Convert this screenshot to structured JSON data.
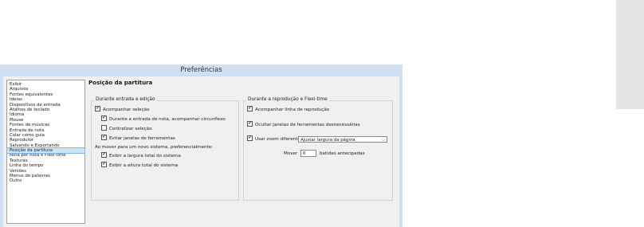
{
  "window": {
    "title": "Preferências"
  },
  "categories": [
    {
      "label": "Exibir",
      "selected": false
    },
    {
      "label": "Arquivos",
      "selected": false
    },
    {
      "label": "Fontes equivalentes",
      "selected": false
    },
    {
      "label": "Ideias",
      "selected": false
    },
    {
      "label": "Dispositivos de entrada",
      "selected": false
    },
    {
      "label": "Atalhos de teclado",
      "selected": false
    },
    {
      "label": "Idioma",
      "selected": false
    },
    {
      "label": "Mouse",
      "selected": false
    },
    {
      "label": "Fontes de músicas",
      "selected": false
    },
    {
      "label": "Entrada de nota",
      "selected": false
    },
    {
      "label": "Colar como guia",
      "selected": false
    },
    {
      "label": "Reprodutor",
      "selected": false
    },
    {
      "label": "Salvando e Exportando",
      "selected": false
    },
    {
      "label": "Posição da partitura",
      "selected": true
    },
    {
      "label": "Nota por nota e Flexi-time",
      "selected": false
    },
    {
      "label": "Texturas",
      "selected": false
    },
    {
      "label": "Linha do tempo",
      "selected": false
    },
    {
      "label": "Versões",
      "selected": false
    },
    {
      "label": "Menus de palavras",
      "selected": false
    },
    {
      "label": "Outro",
      "selected": false
    }
  ],
  "page_title": "Posição da partitura",
  "entry_group": {
    "title": "Durante entrada e edição",
    "follow_selection": {
      "label": "Acompanhar seleção",
      "checked": true
    },
    "follow_caret": {
      "label": "Durante a entrada de nota, acompanhar circunflexo",
      "checked": true
    },
    "center_selection": {
      "label": "Centralizar seleção",
      "checked": false
    },
    "avoid_toolbars": {
      "label": "Evitar janelas de ferramentas",
      "checked": true
    },
    "move_system_text": "Ao mover para um novo sistema, preferencialmente:",
    "full_width": {
      "label": "Exibir a largura total do sistema",
      "checked": true
    },
    "full_height": {
      "label": "Exibir a altura total do sistema",
      "checked": true
    }
  },
  "playback_group": {
    "title": "Durante a reprodução e Flexi-time",
    "follow_playline": {
      "label": "Acompanhar linha de reprodução",
      "checked": true
    },
    "hide_toolbars": {
      "label": "Ocultar janelas de ferramentas desnecessárias",
      "checked": true
    },
    "use_zoom": {
      "label": "Usar zoom diferente:",
      "checked": true
    },
    "zoom_value": "Ajustar largura da página",
    "move_label": "Mover",
    "move_value": "0",
    "move_suffix": "batidas antecipadas"
  },
  "check_glyph": "✔"
}
